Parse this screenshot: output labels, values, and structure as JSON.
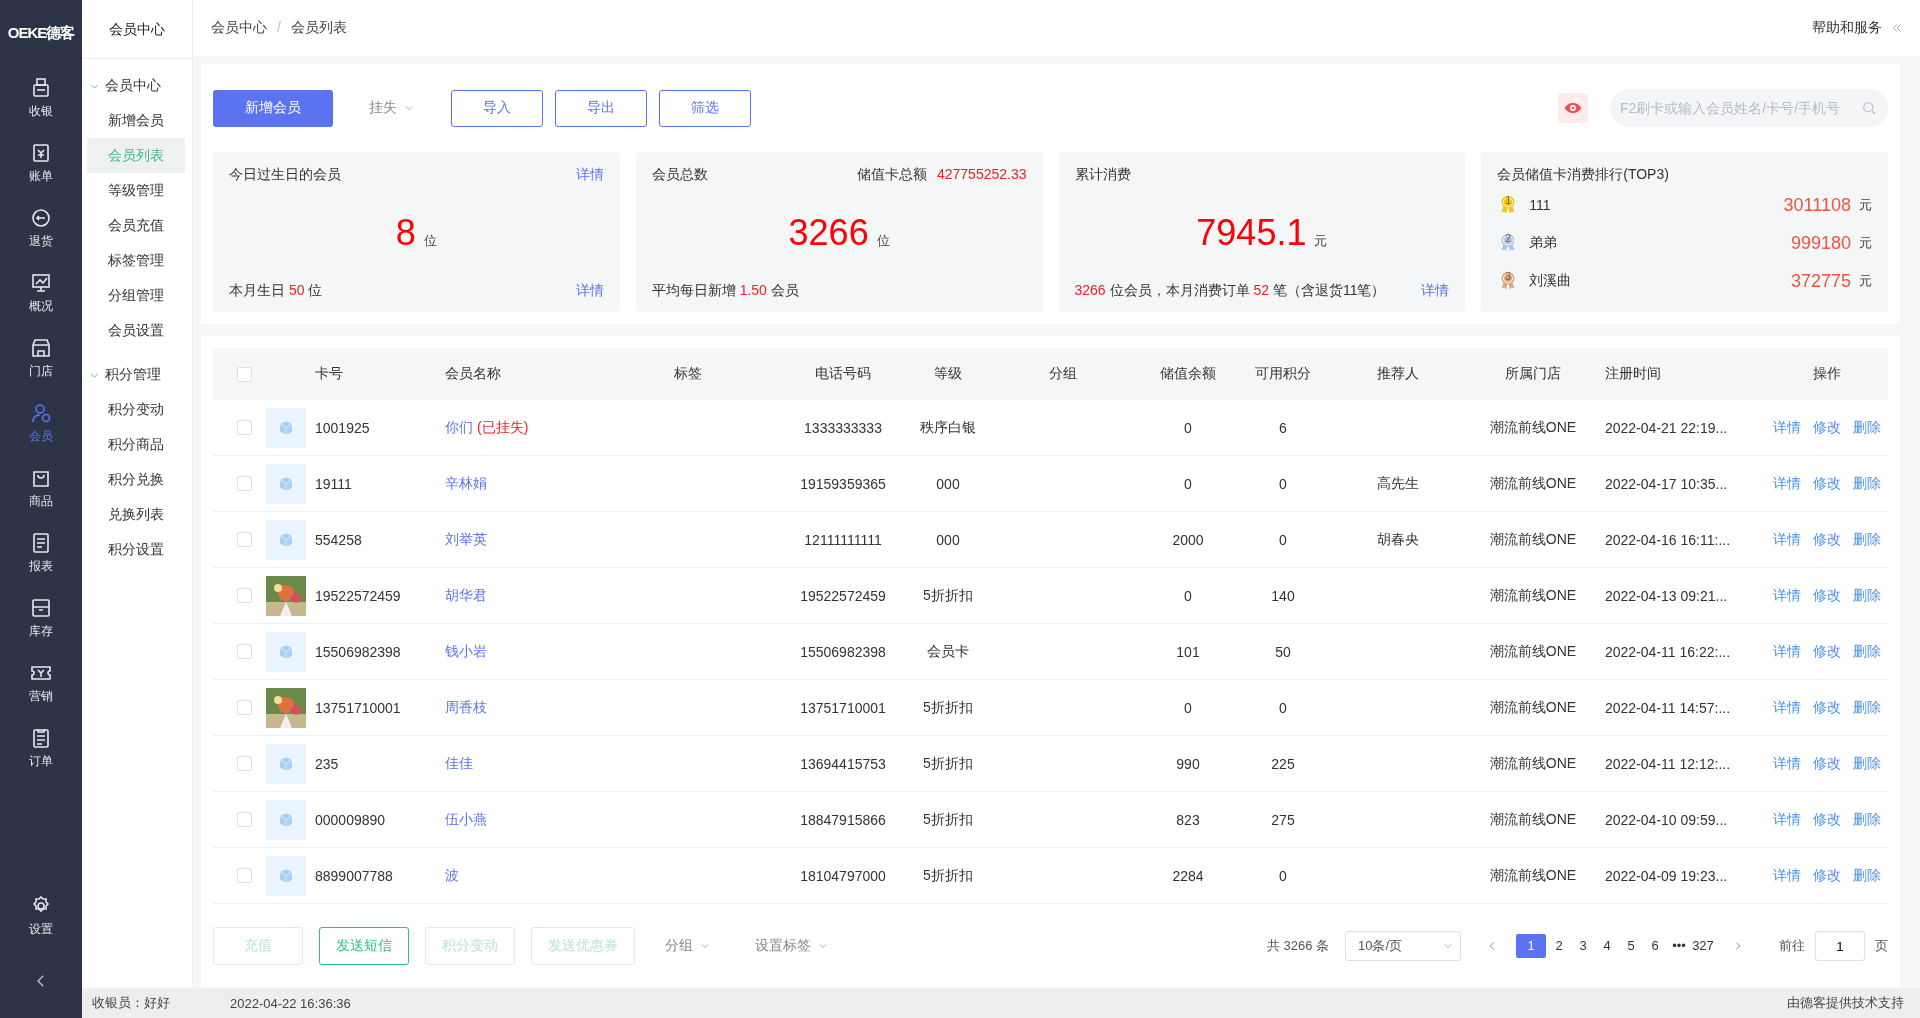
{
  "logo": "OEKE德客",
  "nav": [
    {
      "label": "收银",
      "selected": false
    },
    {
      "label": "账单",
      "selected": false
    },
    {
      "label": "退货",
      "selected": false
    },
    {
      "label": "概况",
      "selected": false
    },
    {
      "label": "门店",
      "selected": false
    },
    {
      "label": "会员",
      "selected": true
    },
    {
      "label": "商品",
      "selected": false
    },
    {
      "label": "报表",
      "selected": false
    },
    {
      "label": "库存",
      "selected": false
    },
    {
      "label": "营销",
      "selected": false
    },
    {
      "label": "订单",
      "selected": false
    }
  ],
  "nav_bottom": {
    "label": "设置"
  },
  "submenu": {
    "title": "会员中心",
    "groups": [
      {
        "label": "会员中心",
        "expanded": true,
        "children": [
          {
            "label": "新增会员",
            "selected": false
          },
          {
            "label": "会员列表",
            "selected": true
          },
          {
            "label": "等级管理",
            "selected": false
          },
          {
            "label": "会员充值",
            "selected": false
          },
          {
            "label": "标签管理",
            "selected": false
          },
          {
            "label": "分组管理",
            "selected": false
          },
          {
            "label": "会员设置",
            "selected": false
          }
        ]
      },
      {
        "label": "积分管理",
        "expanded": true,
        "children": [
          {
            "label": "积分变动",
            "selected": false
          },
          {
            "label": "积分商品",
            "selected": false
          },
          {
            "label": "积分兑换",
            "selected": false
          },
          {
            "label": "兑换列表",
            "selected": false
          },
          {
            "label": "积分设置",
            "selected": false
          }
        ]
      }
    ]
  },
  "breadcrumb": [
    "会员中心",
    "会员列表"
  ],
  "breadcrumb_separator": "/",
  "help": "帮助和服务",
  "toolbar": {
    "primary": "新增会员",
    "dropdown": "挂失",
    "buttons": [
      "导入",
      "导出",
      "筛选"
    ],
    "search": {
      "placeholder": "F2刷卡或输入会员姓名/卡号/手机号"
    }
  },
  "cards": [
    {
      "kind": "stat",
      "title": "今日过生日的会员",
      "top_link": "详情",
      "value": "8",
      "unit": "位",
      "footer": [
        {
          "text": "本月生日 ",
          "red": false
        },
        {
          "text": "50",
          "red": true
        },
        {
          "text": " 位",
          "red": false
        }
      ],
      "footer_link": "详情"
    },
    {
      "kind": "stat",
      "title": "会员总数",
      "extra_label": "储值卡总额",
      "extra_value": "427755252.33",
      "value": "3266",
      "unit": "位",
      "footer": [
        {
          "text": "平均每日新增 ",
          "red": false
        },
        {
          "text": "1.50",
          "red": true
        },
        {
          "text": " 会员",
          "red": false
        }
      ]
    },
    {
      "kind": "stat",
      "title": "累计消费",
      "value": "7945.1",
      "unit": "元",
      "footer": [
        {
          "text": "3266",
          "red": true
        },
        {
          "text": " 位会员，本月消费订单 ",
          "red": false
        },
        {
          "text": "52",
          "red": true
        },
        {
          "text": " 笔（含退货11笔）",
          "red": false
        }
      ],
      "footer_link": "详情"
    },
    {
      "kind": "ranking",
      "title": "会员储值卡消费排行(TOP3)",
      "items": [
        {
          "rank": "1",
          "color": "#f5c400",
          "name": "111",
          "amount": "3011108",
          "unit": "元"
        },
        {
          "rank": "2",
          "color": "#a9c4e8",
          "name": "弟弟",
          "amount": "999180",
          "unit": "元"
        },
        {
          "rank": "3",
          "color": "#d9a77a",
          "name": "刘溪曲",
          "amount": "372775",
          "unit": "元"
        }
      ]
    }
  ],
  "table": {
    "columns": [
      "卡号",
      "会员名称",
      "标签",
      "电话号码",
      "等级",
      "分组",
      "储值余额",
      "可用积分",
      "推荐人",
      "所属门店",
      "注册时间",
      "操作"
    ],
    "select_all_checked": false,
    "rows": [
      {
        "checked": false,
        "kind": "placeholder",
        "card": "1001925",
        "name": "你们",
        "lost": "(已挂失)",
        "phone": "1333333333",
        "level": "秩序白银",
        "balance": "0",
        "points": "6",
        "store": "潮流前线ONE",
        "time": "2022-04-21 22:19...",
        "actions": [
          "详情",
          "修改",
          "删除"
        ]
      },
      {
        "checked": false,
        "kind": "placeholder",
        "card": "19111",
        "name": "辛林娟",
        "phone": "19159359365",
        "level": "000",
        "balance": "0",
        "points": "0",
        "referrer": "高先生",
        "store": "潮流前线ONE",
        "time": "2022-04-17 10:35...",
        "actions": [
          "详情",
          "修改",
          "删除"
        ]
      },
      {
        "checked": false,
        "kind": "placeholder",
        "card": "554258",
        "name": "刘举英",
        "phone": "12111111111",
        "level": "000",
        "balance": "2000",
        "points": "0",
        "referrer": "胡春央",
        "store": "潮流前线ONE",
        "time": "2022-04-16 16:11:...",
        "actions": [
          "详情",
          "修改",
          "删除"
        ]
      },
      {
        "checked": false,
        "card": "19522572459",
        "name": "胡华君",
        "phone": "19522572459",
        "level": "5折折扣",
        "balance": "0",
        "points": "140",
        "store": "潮流前线ONE",
        "time": "2022-04-13 09:21...",
        "actions": [
          "详情",
          "修改",
          "删除"
        ]
      },
      {
        "checked": false,
        "kind": "placeholder",
        "card": "15506982398",
        "name": "钱小岩",
        "phone": "15506982398",
        "level": "会员卡",
        "balance": "101",
        "points": "50",
        "store": "潮流前线ONE",
        "time": "2022-04-11 16:22:...",
        "actions": [
          "详情",
          "修改",
          "删除"
        ]
      },
      {
        "checked": false,
        "card": "13751710001",
        "name": "周香枝",
        "phone": "13751710001",
        "level": "5折折扣",
        "balance": "0",
        "points": "0",
        "store": "潮流前线ONE",
        "time": "2022-04-11 14:57:...",
        "actions": [
          "详情",
          "修改",
          "删除"
        ]
      },
      {
        "checked": false,
        "kind": "placeholder",
        "card": "235",
        "name": "佳佳",
        "phone": "13694415753",
        "level": "5折折扣",
        "balance": "990",
        "points": "225",
        "store": "潮流前线ONE",
        "time": "2022-04-11 12:12:...",
        "actions": [
          "详情",
          "修改",
          "删除"
        ]
      },
      {
        "checked": false,
        "kind": "placeholder",
        "card": "000009890",
        "name": "伍小燕",
        "phone": "18847915866",
        "level": "5折折扣",
        "balance": "823",
        "points": "275",
        "store": "潮流前线ONE",
        "time": "2022-04-10 09:59...",
        "actions": [
          "详情",
          "修改",
          "删除"
        ]
      },
      {
        "checked": false,
        "kind": "placeholder",
        "card": "8899007788",
        "name": "波",
        "phone": "18104797000",
        "level": "5折折扣",
        "balance": "2284",
        "points": "0",
        "store": "潮流前线ONE",
        "time": "2022-04-09 19:23...",
        "actions": [
          "详情",
          "修改",
          "删除"
        ]
      }
    ]
  },
  "bulk": [
    {
      "kind": "button",
      "label": "充值",
      "disabled": true
    },
    {
      "kind": "button",
      "label": "发送短信",
      "disabled": false
    },
    {
      "kind": "button",
      "label": "积分变动",
      "disabled": true
    },
    {
      "kind": "button",
      "label": "发送优惠券",
      "disabled": true
    },
    {
      "kind": "dropdown",
      "label": "分组"
    },
    {
      "kind": "dropdown",
      "label": "设置标签"
    }
  ],
  "pagination": {
    "total": "共 3266 条",
    "page_size": "10条/页",
    "pages": [
      {
        "label": "1",
        "selected": true
      },
      {
        "label": "2",
        "selected": false
      },
      {
        "label": "3",
        "selected": false
      },
      {
        "label": "4",
        "selected": false
      },
      {
        "label": "5",
        "selected": false
      },
      {
        "label": "6",
        "selected": false
      },
      {
        "label": "•••",
        "selected": false
      },
      {
        "label": "327",
        "selected": false
      }
    ],
    "goto_label": "前往",
    "goto_value": "1",
    "goto_unit": "页"
  },
  "status_bar": {
    "cashier": "收银员：好好",
    "time": "2022-04-22 16:36:36",
    "credit": "由德客提供技术支持"
  }
}
